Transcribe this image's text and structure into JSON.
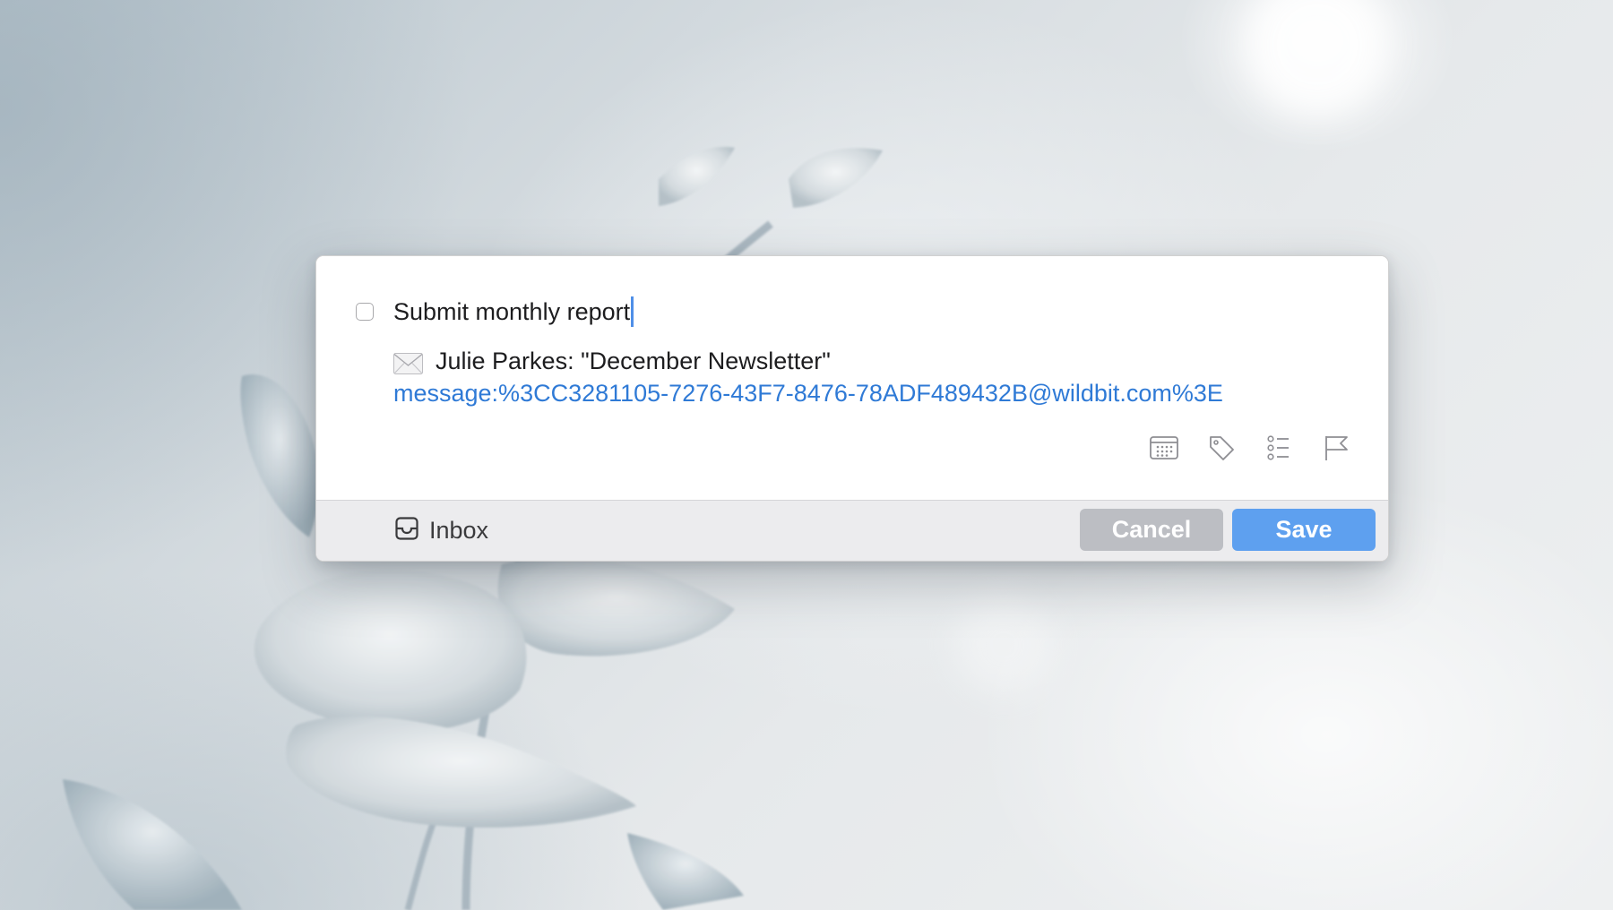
{
  "task": {
    "title": "Submit monthly report",
    "note_icon": "envelope-icon",
    "note_text": "Julie Parkes: \"December Newsletter\"",
    "link": "message:%3CC3281105-7276-43F7-8476-78ADF489432B@wildbit.com%3E"
  },
  "toolbar": {
    "icons": [
      "calendar-icon",
      "tag-icon",
      "checklist-icon",
      "flag-icon"
    ]
  },
  "footer": {
    "list_icon": "inbox-icon",
    "list_label": "Inbox",
    "cancel_label": "Cancel",
    "save_label": "Save"
  },
  "colors": {
    "accent": "#5ea0ef",
    "link": "#2f7ad6",
    "cancel_button": "#bcbec3",
    "caret": "#4f8fe8"
  }
}
